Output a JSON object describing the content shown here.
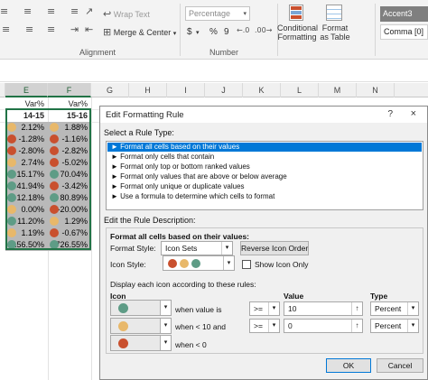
{
  "ribbon": {
    "wrap_text": "Wrap Text",
    "merge_center": "Merge & Center",
    "number_format": "Percentage",
    "currency_symbol": "$",
    "percent_symbol": "%",
    "comma_symbol": "9",
    "conditional_formatting": "Conditional Formatting",
    "format_as_table": "Format as Table",
    "style_accent": "Accent3",
    "style_comma": "Comma [0]",
    "group_alignment": "Alignment",
    "group_number": "Number"
  },
  "grid": {
    "columns": [
      "E",
      "F",
      "G",
      "H",
      "I",
      "J",
      "K",
      "L",
      "M",
      "N"
    ],
    "header_row_1": [
      "Var%",
      "Var%"
    ],
    "header_row_2": [
      "14-15",
      "15-16"
    ],
    "rows": [
      {
        "e": "2.12%",
        "e_icon": "yellow",
        "f": "1.88%",
        "f_icon": "yellow"
      },
      {
        "e": "-1.28%",
        "e_icon": "red",
        "f": "-1.16%",
        "f_icon": "red"
      },
      {
        "e": "-2.80%",
        "e_icon": "red",
        "f": "-2.82%",
        "f_icon": "red"
      },
      {
        "e": "2.74%",
        "e_icon": "yellow",
        "f": "-5.02%",
        "f_icon": "red"
      },
      {
        "e": "15.17%",
        "e_icon": "green",
        "f": "70.04%",
        "f_icon": "green"
      },
      {
        "e": "41.94%",
        "e_icon": "green",
        "f": "-3.42%",
        "f_icon": "red"
      },
      {
        "e": "12.18%",
        "e_icon": "green",
        "f": "80.89%",
        "f_icon": "green"
      },
      {
        "e": "0.00%",
        "e_icon": "yellow",
        "f": "-20.00%",
        "f_icon": "red"
      },
      {
        "e": "11.20%",
        "e_icon": "green",
        "f": "1.29%",
        "f_icon": "yellow"
      },
      {
        "e": "1.19%",
        "e_icon": "yellow",
        "f": "-0.67%",
        "f_icon": "red"
      },
      {
        "e": "156.50%",
        "e_icon": "green",
        "f": "726.55%",
        "f_icon": "green"
      }
    ]
  },
  "icon_colors": {
    "green": "#5e9c86",
    "yellow": "#e8b86a",
    "red": "#c9502e"
  },
  "dialog": {
    "title": "Edit Formatting Rule",
    "help": "?",
    "close": "×",
    "select_rule_type_label": "Select a Rule Type:",
    "rule_types": [
      "► Format all cells based on their values",
      "► Format only cells that contain",
      "► Format only top or bottom ranked values",
      "► Format only values that are above or below average",
      "► Format only unique or duplicate values",
      "► Use a formula to determine which cells to format"
    ],
    "edit_desc_label": "Edit the Rule Description:",
    "format_all_label": "Format all cells based on their values:",
    "format_style_label": "Format Style:",
    "format_style_value": "Icon Sets",
    "reverse_icon_order": "Reverse Icon Order",
    "icon_style_label": "Icon Style:",
    "show_icon_only": "Show Icon Only",
    "display_each_label": "Display each icon according to these rules:",
    "col_icon": "Icon",
    "col_value": "Value",
    "col_type": "Type",
    "rules": [
      {
        "icon": "green",
        "condition": "when value is",
        "operator": ">=",
        "value": "10",
        "type": "Percent"
      },
      {
        "icon": "yellow",
        "condition": "when < 10 and",
        "operator": ">=",
        "value": "0",
        "type": "Percent"
      },
      {
        "icon": "red",
        "condition": "when < 0",
        "operator": "",
        "value": "",
        "type": ""
      }
    ],
    "ok": "OK",
    "cancel": "Cancel"
  }
}
